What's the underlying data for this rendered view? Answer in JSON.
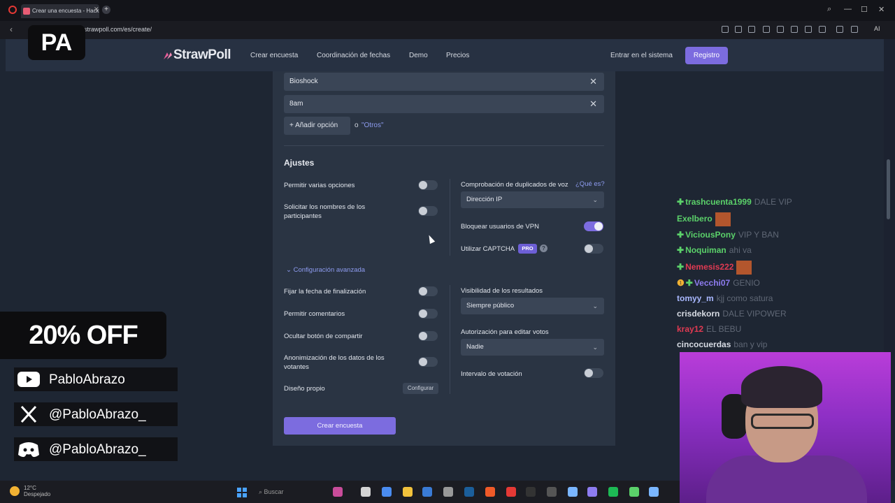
{
  "browser": {
    "tab_title": "Crear una encuesta - Hack",
    "tab_close": "✕",
    "new_tab": "+",
    "url": "strawpoll.com/es/create/",
    "ai_label": "AI",
    "win_min": "—",
    "win_max": "☐",
    "win_close": "✕"
  },
  "site": {
    "logo": "StrawPoll",
    "nav": [
      "Crear encuesta",
      "Coordinación de fechas",
      "Demo",
      "Precios"
    ],
    "login": "Entrar en el sistema",
    "register": "Registro",
    "brand_color": "#7c6cdf"
  },
  "form": {
    "options": [
      {
        "value": "Bioshock"
      },
      {
        "value": "8am"
      }
    ],
    "option_remove_icon": "✕",
    "add_option": "Añadir opción",
    "or": "o",
    "others": "\"Otros\"",
    "settings_heading": "Ajustes",
    "left_settings": [
      {
        "label": "Permitir varias opciones",
        "on": false
      },
      {
        "label": "Solicitar los nombres de los participantes",
        "on": false
      }
    ],
    "duplicate_check_label": "Comprobación de duplicados de voz",
    "duplicate_check_help": "¿Qué es?",
    "duplicate_check_value": "Dirección IP",
    "block_vpn_label": "Bloquear usuarios de VPN",
    "block_vpn_on": true,
    "captcha_label": "Utilizar CAPTCHA",
    "captcha_badge": "PRO",
    "captcha_help": "?",
    "captcha_on": false,
    "advanced_toggle": "Configuración avanzada",
    "advanced_left": [
      {
        "label": "Fijar la fecha de finalización",
        "on": false
      },
      {
        "label": "Permitir comentarios",
        "on": false
      },
      {
        "label": "Ocultar botón de compartir",
        "on": false
      },
      {
        "label": "Anonimización de los datos de los votantes",
        "on": false
      }
    ],
    "custom_design_label": "Diseño propio",
    "custom_design_button": "Configurar",
    "results_visibility_label": "Visibilidad de los resultados",
    "results_visibility_value": "Siempre público",
    "edit_votes_label": "Autorización para editar votos",
    "edit_votes_value": "Nadie",
    "voting_interval_label": "Intervalo de votación",
    "voting_interval_on": false,
    "submit": "Crear encuesta"
  },
  "overlay": {
    "logo": "PA",
    "promo": "20% OFF",
    "socials": [
      {
        "icon": "youtube-icon",
        "handle": "PabloAbrazo"
      },
      {
        "icon": "x-icon",
        "handle": "@PabloAbrazo_"
      },
      {
        "icon": "discord-icon",
        "handle": "@PabloAbrazo_"
      }
    ]
  },
  "chat": [
    {
      "user": "trashcuenta1999",
      "color": "#5bd16a",
      "badge": "✚",
      "msg": "DALE VIP"
    },
    {
      "user": "Exelbero",
      "color": "#5bd16a",
      "badge": "",
      "msg": "",
      "emote": true
    },
    {
      "user": "ViciousPony",
      "color": "#5bd16a",
      "badge": "✚",
      "msg": "VIP Y BAN"
    },
    {
      "user": "Noquiman",
      "color": "#5bd16a",
      "badge": "✚",
      "msg": "ahi va"
    },
    {
      "user": "Nemesis222",
      "color": "#e03a52",
      "badge": "✚",
      "msg": "",
      "emote": true
    },
    {
      "user": "Vecchi07",
      "color": "#8e7cf0",
      "badge": "❶ ✚",
      "msg": "GENIO"
    },
    {
      "user": "tomyy_m",
      "color": "#a9b8ff",
      "badge": "",
      "msg": "kjj como satura"
    },
    {
      "user": "crisdekorn",
      "color": "#d8dce4",
      "badge": "",
      "msg": "DALE VIPOWER"
    },
    {
      "user": "kray12",
      "color": "#e03a52",
      "badge": "",
      "msg": "EL BEBU"
    },
    {
      "user": "cincocuerdas",
      "color": "#d8dce4",
      "badge": "",
      "msg": "ban y vip"
    }
  ],
  "taskbar": {
    "temp": "12°C",
    "weather": "Despejado",
    "search": "Buscar"
  }
}
